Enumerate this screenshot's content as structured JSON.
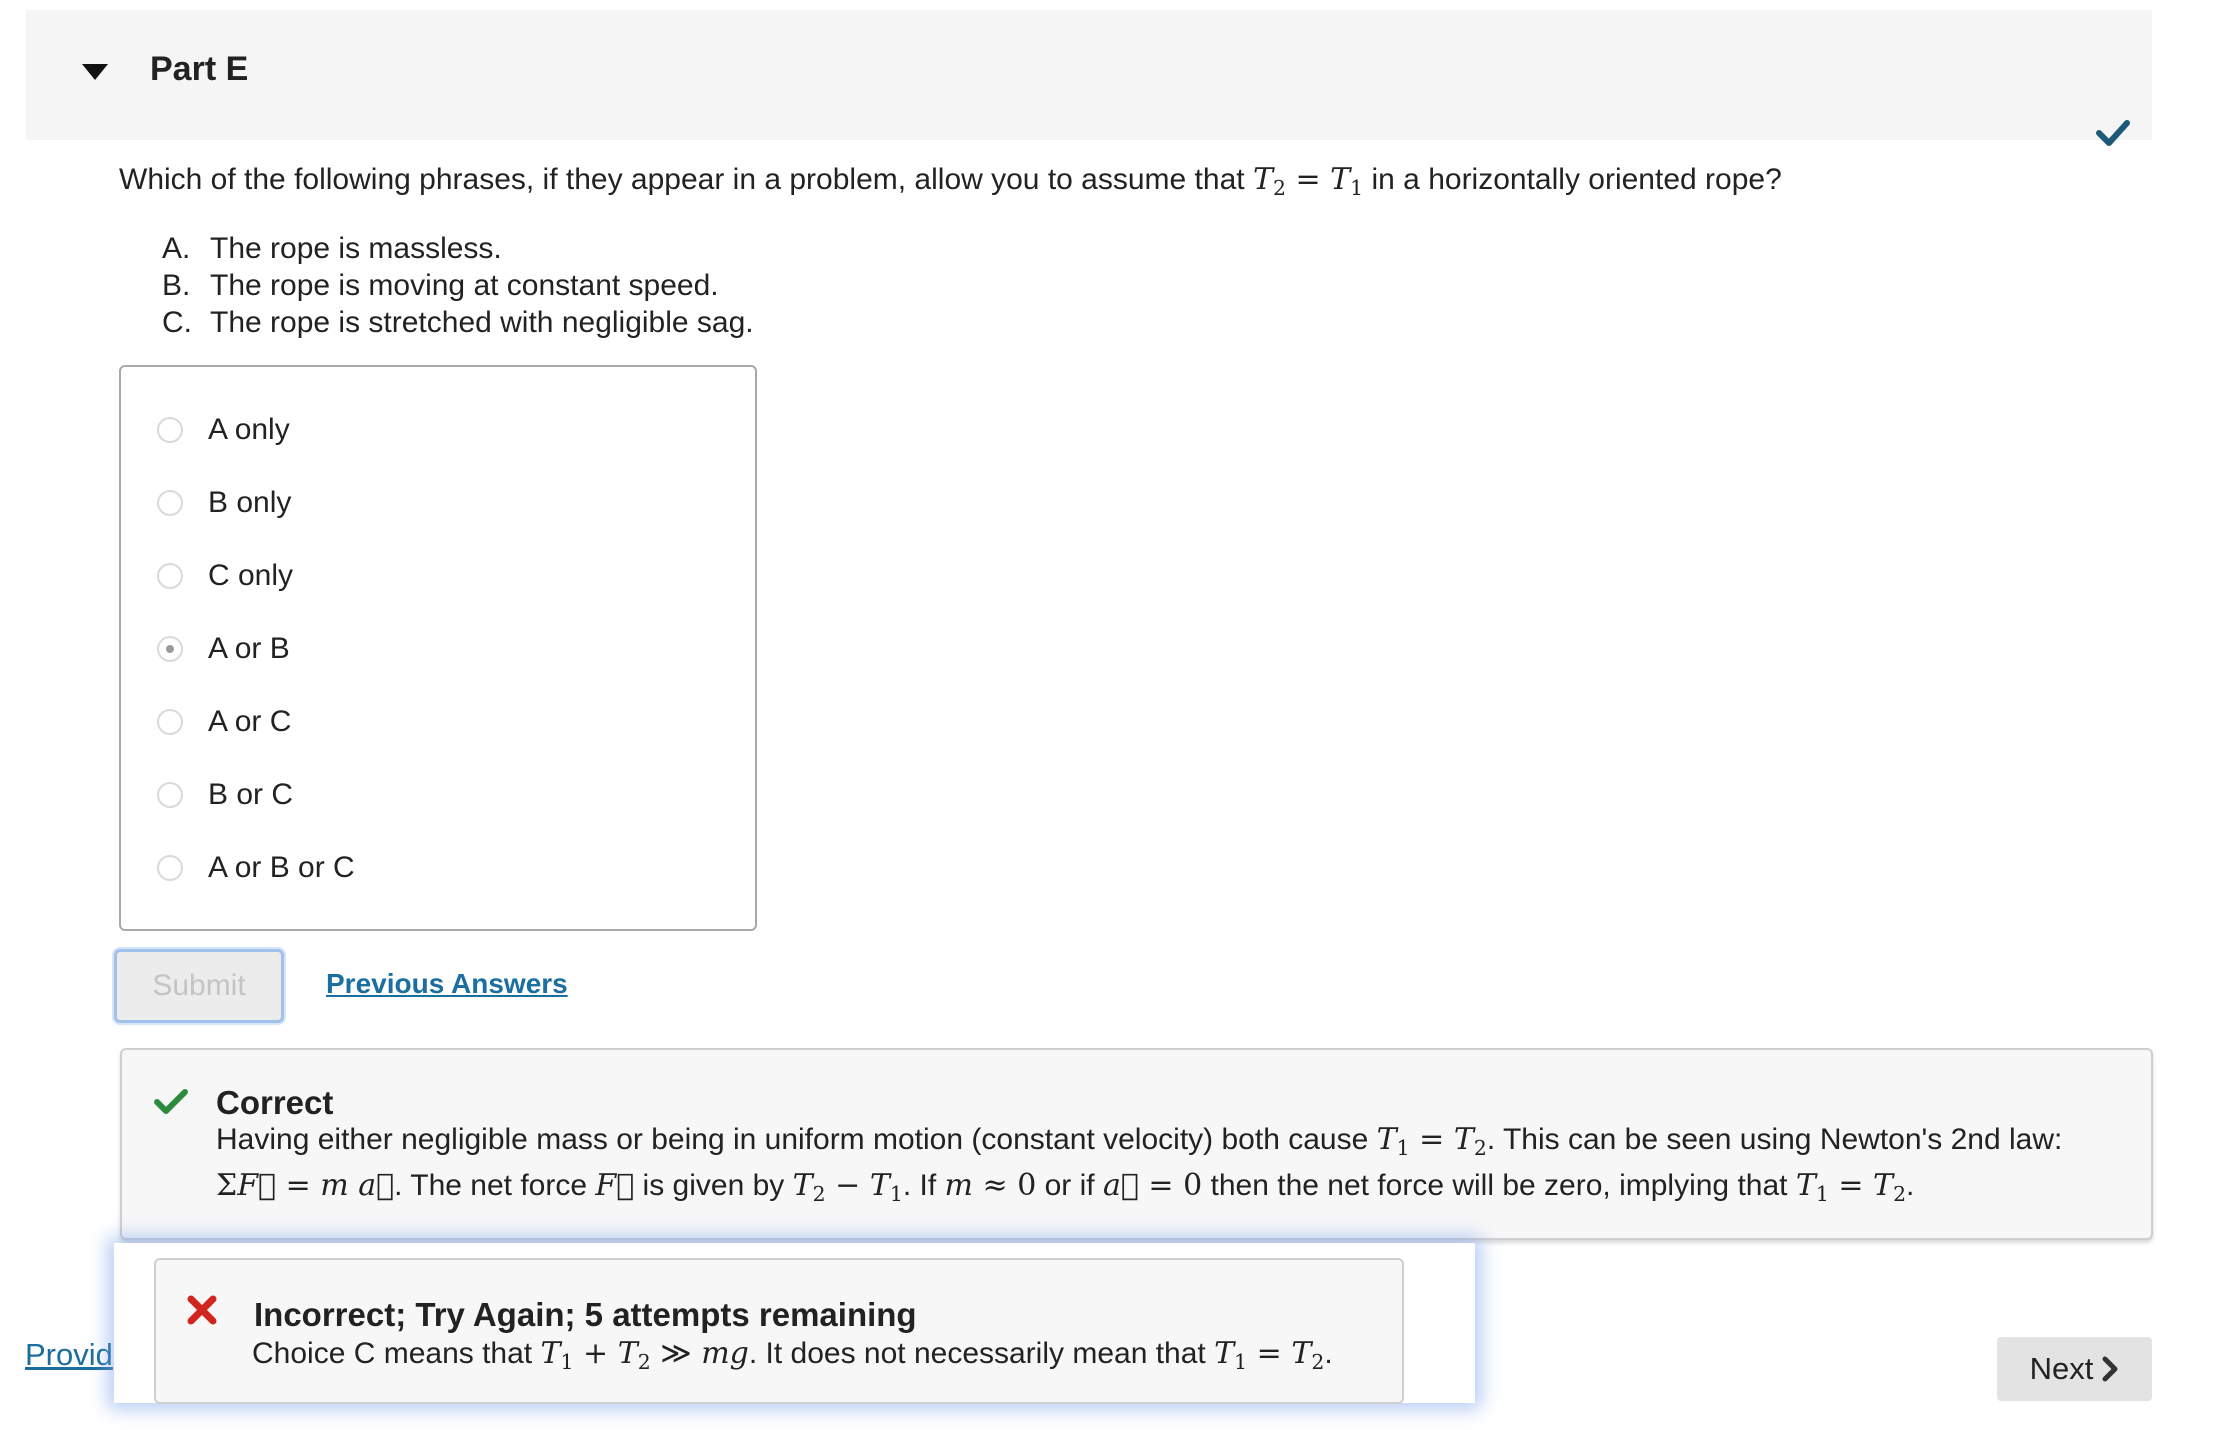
{
  "header": {
    "part_title": "Part E",
    "status": "check-icon",
    "accent_color": "#1d5a7a"
  },
  "question": {
    "prefix": "Which of the following phrases, if they appear in a problem, allow you to assume that ",
    "math": "T2 = T1",
    "suffix": " in a horizontally oriented rope?",
    "statements": [
      {
        "letter": "A.",
        "text": "The rope is massless."
      },
      {
        "letter": "B.",
        "text": "The rope is moving at constant speed."
      },
      {
        "letter": "C.",
        "text": "The rope is stretched with negligible sag."
      }
    ]
  },
  "choices": [
    {
      "label": "A only",
      "selected": false
    },
    {
      "label": "B only",
      "selected": false
    },
    {
      "label": "C only",
      "selected": false
    },
    {
      "label": "A or B",
      "selected": true
    },
    {
      "label": "A or C",
      "selected": false
    },
    {
      "label": "B or C",
      "selected": false
    },
    {
      "label": "A or B or C",
      "selected": false
    }
  ],
  "actions": {
    "submit_label": "Submit",
    "previous_answers_label": "Previous Answers"
  },
  "correct_feedback": {
    "title": "Correct",
    "line1_text_a": "Having either negligible mass or being in uniform motion (constant velocity) both cause ",
    "line1_text_b": ". This can be seen using Newton's 2nd law:",
    "line2_text_a": ". The net force ",
    "line2_text_b": " is given by ",
    "line2_text_c": ". If ",
    "line2_text_d": " or if ",
    "line2_text_e": " then the net force will be zero, implying that ",
    "line2_text_f": ".",
    "status_color": "#2e8b3e"
  },
  "incorrect_feedback": {
    "title": "Incorrect; Try Again; 5 attempts remaining",
    "text_a": "Choice C means that ",
    "text_b": ". It does not necessarily mean that ",
    "text_c": ".",
    "status_color": "#d0261f"
  },
  "footer": {
    "provide_feedback_label": "Provid",
    "next_label": "Next"
  }
}
